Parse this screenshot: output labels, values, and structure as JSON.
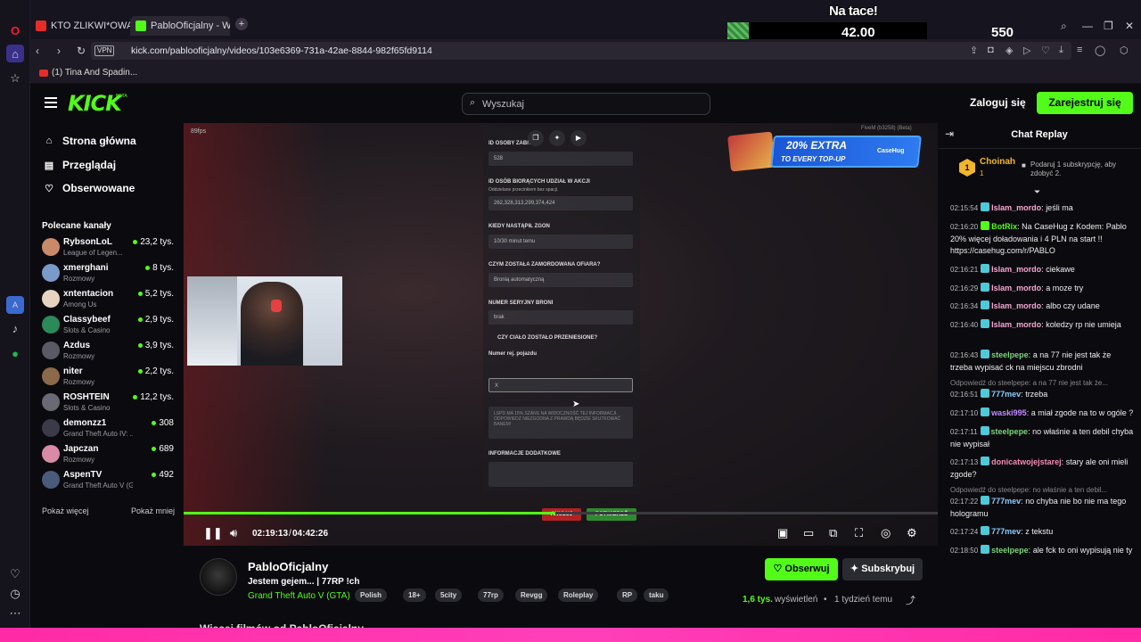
{
  "browser": {
    "tabs": [
      {
        "label": "KTO ZLIKWI*OWAŁ PABLO",
        "favicon_color": "#e52d27"
      },
      {
        "label": "PabloOficjalny - Watc",
        "favicon_color": "#53fc18"
      }
    ],
    "url": "kick.com/pablooficjalny/videos/103e6369-731a-42ae-8844-982f65fd9114",
    "vpn_label": "VPN",
    "bookmark": "(1) Tina And Spadin..."
  },
  "overlay": {
    "title": "Na tace!",
    "value": "42.00",
    "count": "550"
  },
  "header": {
    "logo": "KICK",
    "logo_sup": "BETA",
    "search_placeholder": "Wyszukaj",
    "login_label": "Zaloguj się",
    "register_label": "Zarejestruj się"
  },
  "sidebar": {
    "nav": [
      {
        "label": "Strona główna",
        "icon": "home-icon"
      },
      {
        "label": "Przeglądaj",
        "icon": "browse-icon"
      },
      {
        "label": "Obserwowane",
        "icon": "heart-icon"
      }
    ],
    "recommended_title": "Polecane kanały",
    "channels": [
      {
        "name": "RybsonLoL",
        "category": "League of Legen...",
        "viewers": "23,2 tys.",
        "color": "#c98a6a"
      },
      {
        "name": "xmerghani",
        "category": "Rozmowy",
        "viewers": "8 tys.",
        "color": "#7a9ac9"
      },
      {
        "name": "xntentacion",
        "category": "Among Us",
        "viewers": "5,2 tys.",
        "color": "#e6d4c0"
      },
      {
        "name": "Classybeef",
        "category": "Slots & Casino",
        "viewers": "2,9 tys.",
        "color": "#2c8a5a"
      },
      {
        "name": "Azdus",
        "category": "Rozmowy",
        "viewers": "3,9 tys.",
        "color": "#5a5a66"
      },
      {
        "name": "niter",
        "category": "Rozmowy",
        "viewers": "2,2 tys.",
        "color": "#8a6a4a"
      },
      {
        "name": "ROSHTEIN",
        "category": "Slots & Casino",
        "viewers": "12,2 tys.",
        "color": "#6a6a74"
      },
      {
        "name": "demonzz1",
        "category": "Grand Theft Auto IV: ...",
        "viewers": "308",
        "color": "#3a3a48"
      },
      {
        "name": "Japczan",
        "category": "Rozmowy",
        "viewers": "689",
        "color": "#d98aa6"
      },
      {
        "name": "AspenTV",
        "category": "Grand Theft Auto V (G...",
        "viewers": "492",
        "color": "#4a5a7a"
      }
    ],
    "show_more": "Pokaż więcej",
    "show_less": "Pokaż mniej"
  },
  "video": {
    "fps": "89fps",
    "time_current": "02:19:13",
    "time_separator": "/",
    "time_total": "04:42:26",
    "progress": 0.493,
    "game_form": {
      "labels": [
        "ID OSOBY ZABIT...",
        "ID OSÓB BIORĄCYCH UDZIAŁ W AKCJI",
        "KIEDY NASTĄPIŁ ZGON",
        "CZYM ZOSTAŁA ZAMORDOWANA OFIARA?",
        "NUMER SERYJNY BRONI",
        "CZY CIAŁO ZOSTAŁO PRZENIESIONE?",
        "Numer rej. pojazdu",
        "INFORMACJE DODATKOWE"
      ],
      "hint": "Oddzielane przecinkiem bez spacji.",
      "values": [
        "528",
        "262,328,313,299,374,424",
        "10/30 minut temu",
        "Bronią automatyczną",
        "brak",
        "X"
      ],
      "warning": "LSPD MA 15% SZANS NA WIDOCZNOŚĆ TEJ INFORMACJI. ODPOWIEDŹ NIEZGODNA Z PRAWDĄ BĘDZIE SKUTKOWAĆ BANEM!",
      "cancel": "ANULUJ",
      "confirm": "POTWIERDŹ",
      "server_tag": "FiveM (b3258) (Beta)"
    },
    "promo": {
      "line1": "20% EXTRA",
      "line2": "TO EVERY TOP-UP",
      "brand": "CaseHug"
    }
  },
  "channel_info": {
    "name": "PabloOficjalny",
    "title": "Jestem gejem... | 77RP !ch",
    "game": "Grand Theft Auto V (GTA)",
    "tags": [
      "Polish",
      "18+",
      "5city",
      "77rp",
      "Revgg",
      "Roleplay",
      "RP",
      "taku"
    ],
    "follow_label": "Obserwuj",
    "subscribe_label": "Subskrybuj",
    "views_count": "1,6 tys.",
    "views_label": "wyświetleń",
    "separator": "•",
    "posted": "1 tydzień temu",
    "more_heading": "Więcej filmów od PabloOficjalny"
  },
  "chat": {
    "title": "Chat Replay",
    "gift": {
      "badge": "1",
      "user": "Choinah",
      "count": "1",
      "text": "Podaruj 1 subskrypcję, aby zdobyć 2."
    },
    "messages": [
      {
        "time": "02:15:54",
        "user": "Islam_mordo",
        "color": "#f6a6d1",
        "text": "jeśli ma"
      },
      {
        "time": "02:16:20",
        "user": "BotRix",
        "color": "#53fc18",
        "text": "Na CaseHug z Kodem: Pablo 20% więcej doładowania i 4 PLN na start !! https://casehug.com/r/PABLO"
      },
      {
        "time": "02:16:21",
        "user": "Islam_mordo",
        "color": "#f6a6d1",
        "text": "ciekawe"
      },
      {
        "time": "02:16:29",
        "user": "Islam_mordo",
        "color": "#f6a6d1",
        "text": "a moze try"
      },
      {
        "time": "02:16:34",
        "user": "Islam_mordo",
        "color": "#f6a6d1",
        "text": "albo czy udane"
      },
      {
        "time": "02:16:40",
        "user": "Islam_mordo",
        "color": "#f6a6d1",
        "text": "koledzy rp nie umieja"
      },
      {
        "time": "02:16:43",
        "user": "steelpepe",
        "color": "#7ad67a",
        "text": "a na 77 nie jest tak że trzeba wypisać ck na miejscu zbrodni"
      },
      {
        "time": "02:16:51",
        "user": "777mev",
        "color": "#8ecbff",
        "text": "trzeba"
      },
      {
        "time": "02:17:10",
        "user": "waski995",
        "color": "#c38bff",
        "text": "a miał zgode na to w ogóle ?"
      },
      {
        "time": "02:17:11",
        "user": "steelpepe",
        "color": "#7ad67a",
        "text": "no właśnie a ten debil chyba nie wypisał"
      },
      {
        "time": "02:17:13",
        "user": "donicatwojejstarej",
        "color": "#f58ab0",
        "text": "stary ale oni mieli zgode?"
      },
      {
        "time": "02:17:22",
        "user": "777mev",
        "color": "#8ecbff",
        "text": "no chyba nie bo nie ma tego hologramu"
      },
      {
        "time": "02:17:24",
        "user": "777mev",
        "color": "#8ecbff",
        "text": "z tekstu"
      },
      {
        "time": "02:18:50",
        "user": "steelpepe",
        "color": "#7ad67a",
        "text": "ale fck to oni wypisują nie ty"
      }
    ],
    "replies": [
      "Odpowiedź do steelpepe: a na 77 nie jest tak że...",
      "Odpowiedź do steelpepe: no właśnie a ten debil..."
    ]
  }
}
